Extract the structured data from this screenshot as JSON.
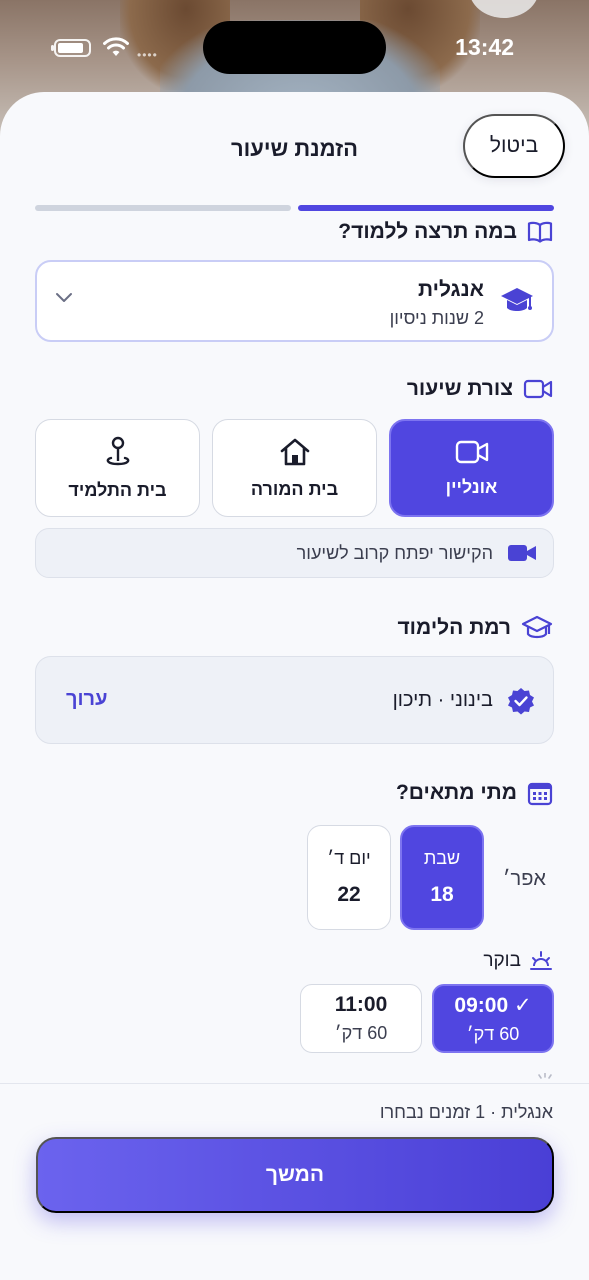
{
  "status_bar": {
    "time": "13:42"
  },
  "header": {
    "title": "הזמנת שיעור",
    "cancel_label": "ביטול"
  },
  "progress": {
    "current_step": 1,
    "total_steps": 2
  },
  "subject_section": {
    "title": "במה תרצה ללמוד?",
    "selected_subject": "אנגלית",
    "experience": "2 שנות ניסיון"
  },
  "lesson_type_section": {
    "title": "צורת שיעור",
    "options": [
      {
        "label": "אונליין",
        "selected": true,
        "icon": "video-icon"
      },
      {
        "label": "בית המורה",
        "selected": false,
        "icon": "home-icon"
      },
      {
        "label": "בית התלמיד",
        "selected": false,
        "icon": "map-pin-icon"
      }
    ],
    "info_text": "הקישור יפתח קרוב לשיעור"
  },
  "level_section": {
    "title": "רמת הלימוד",
    "value": "בינוני · תיכון",
    "edit_label": "ערוך"
  },
  "schedule_section": {
    "title": "מתי מתאים?",
    "month": "אפר׳",
    "dates": [
      {
        "day": "שבת",
        "number": "18",
        "selected": true
      },
      {
        "day": "יום ד׳",
        "number": "22",
        "selected": false
      }
    ],
    "period_label": "בוקר",
    "slots": [
      {
        "time": "09:00 ✓",
        "duration": "60 דק׳",
        "selected": true
      },
      {
        "time": "11:00",
        "duration": "60 דק׳",
        "selected": false
      }
    ]
  },
  "footer": {
    "summary": "אנגלית · 1 זמנים נבחרו",
    "continue_label": "המשך"
  },
  "colors": {
    "accent": "#5046e0",
    "background": "#f8f9fc"
  }
}
